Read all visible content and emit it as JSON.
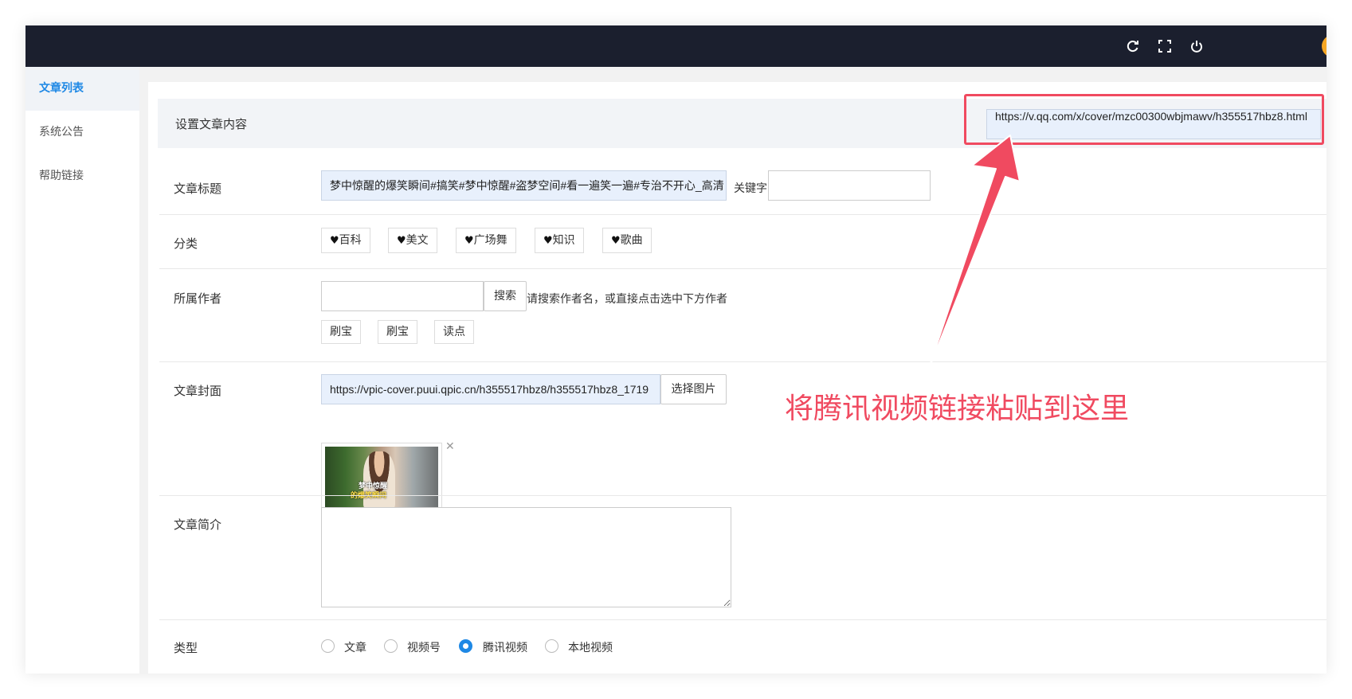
{
  "topbar": {
    "icons": [
      "refresh-icon",
      "fullscreen-icon",
      "power-icon"
    ]
  },
  "sidebar": {
    "items": [
      {
        "label": "文章列表",
        "active": true
      },
      {
        "label": "系统公告",
        "active": false
      },
      {
        "label": "帮助链接",
        "active": false
      }
    ]
  },
  "form": {
    "header_title": "设置文章内容",
    "video_url": "https://v.qq.com/x/cover/mzc00300wbjmawv/h355517hbz8.html",
    "title_label": "文章标题",
    "title_value": "梦中惊醒的爆笑瞬间#搞笑#梦中惊醒#盗梦空间#看一遍笑一遍#专治不开心_高清",
    "keyword_label": "关键字",
    "keyword_value": "",
    "category_label": "分类",
    "categories": [
      "百科",
      "美文",
      "广场舞",
      "知识",
      "歌曲"
    ],
    "author_label": "所属作者",
    "author_value": "",
    "search_button": "搜索",
    "author_hint": "请搜索作者名，或直接点击选中下方作者",
    "authors": [
      "刷宝",
      "刷宝",
      "读点"
    ],
    "cover_label": "文章封面",
    "cover_url": "https://vpic-cover.puui.qpic.cn/h355517hbz8/h355517hbz8_1719",
    "select_image_button": "选择图片",
    "thumb_caption_1": "梦中惊醒",
    "thumb_caption_2": "的爆笑瞬间",
    "intro_label": "文章简介",
    "intro_value": "",
    "type_label": "类型",
    "types": [
      {
        "label": "文章",
        "checked": false
      },
      {
        "label": "视频号",
        "checked": false
      },
      {
        "label": "腾讯视频",
        "checked": true
      },
      {
        "label": "本地视频",
        "checked": false
      }
    ]
  },
  "annotation": {
    "text": "将腾讯视频链接粘贴到这里",
    "color": "#f04a60"
  },
  "colors": {
    "topbar": "#1b1f2e",
    "accent": "#1e88e5",
    "annotation": "#f04a60"
  }
}
